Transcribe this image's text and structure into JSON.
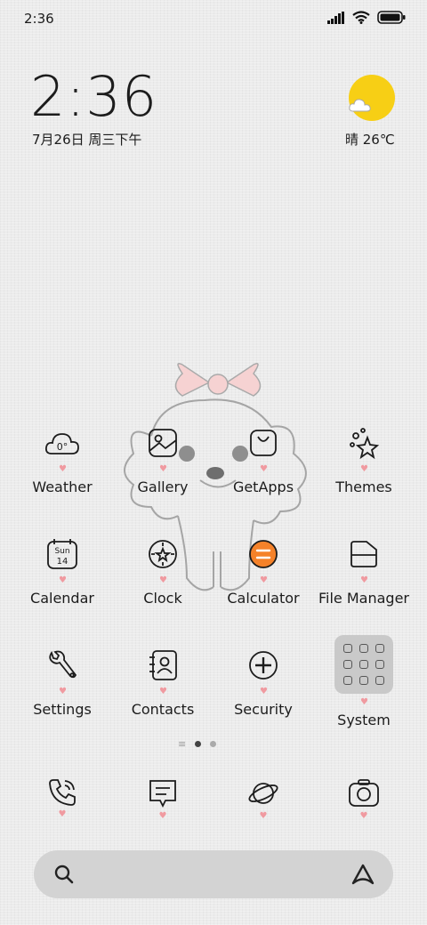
{
  "status": {
    "time": "2:36"
  },
  "clock_widget": {
    "time": "2:36",
    "date": "7月26日 周三下午"
  },
  "weather_widget": {
    "text": "晴 26℃"
  },
  "apps": [
    {
      "label": "Weather",
      "icon": "cloud-icon"
    },
    {
      "label": "Gallery",
      "icon": "image-icon"
    },
    {
      "label": "GetApps",
      "icon": "bag-icon"
    },
    {
      "label": "Themes",
      "icon": "stars-icon"
    },
    {
      "label": "Calendar",
      "icon": "calendar-icon"
    },
    {
      "label": "Clock",
      "icon": "clock-icon"
    },
    {
      "label": "Calculator",
      "icon": "calculator-icon"
    },
    {
      "label": "File Manager",
      "icon": "folder-icon"
    },
    {
      "label": "Settings",
      "icon": "wrench-icon"
    },
    {
      "label": "Contacts",
      "icon": "contacts-icon"
    },
    {
      "label": "Security",
      "icon": "plus-circle-icon"
    },
    {
      "label": "System",
      "icon": "folder-grid-icon"
    }
  ],
  "icons": {
    "weather_temp": "0°",
    "calendar_day": "Sun",
    "calendar_date": "14"
  },
  "dock": [
    {
      "icon": "phone-icon"
    },
    {
      "icon": "message-icon"
    },
    {
      "icon": "planet-icon"
    },
    {
      "icon": "camera-icon"
    }
  ],
  "colors": {
    "accent_pink": "#f09aa0",
    "sun": "#f7cf15",
    "calculator": "#f5822a"
  }
}
